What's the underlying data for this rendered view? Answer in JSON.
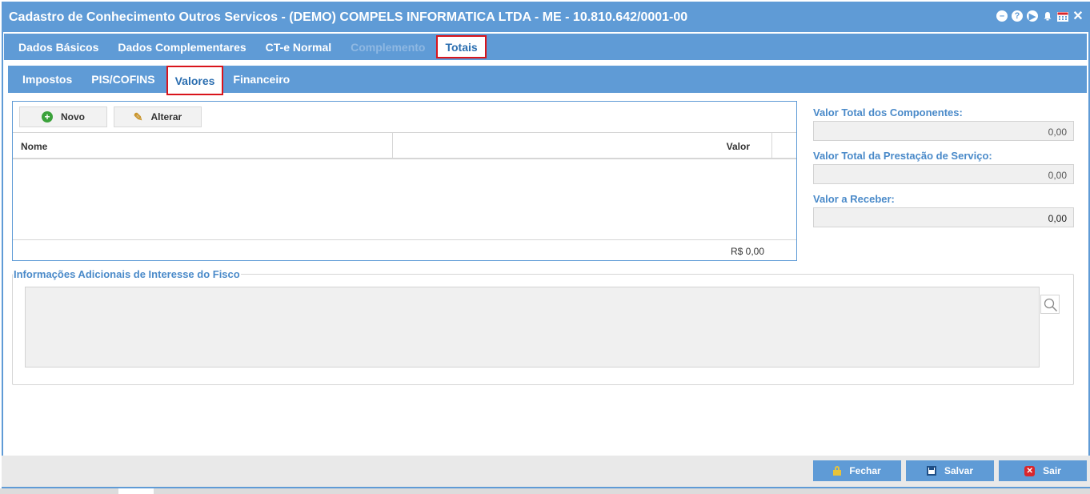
{
  "window": {
    "title": "Cadastro de Conhecimento Outros Servicos - (DEMO) COMPELS INFORMATICA LTDA - ME - 10.810.642/0001-00",
    "icons": [
      "minimize-icon",
      "help-icon",
      "play-icon",
      "bell-icon",
      "calendar-icon",
      "close-icon"
    ]
  },
  "main_tabs": [
    {
      "label": "Dados Básicos",
      "state": "normal"
    },
    {
      "label": "Dados Complementares",
      "state": "normal"
    },
    {
      "label": "CT-e Normal",
      "state": "normal"
    },
    {
      "label": "Complemento",
      "state": "disabled"
    },
    {
      "label": "Totais",
      "state": "active"
    }
  ],
  "sub_tabs": [
    {
      "label": "Impostos",
      "state": "normal"
    },
    {
      "label": "PIS/COFINS",
      "state": "normal"
    },
    {
      "label": "Valores",
      "state": "active"
    },
    {
      "label": "Financeiro",
      "state": "normal"
    }
  ],
  "grid": {
    "new_label": "Novo",
    "edit_label": "Alterar",
    "columns": [
      "Nome",
      "Valor"
    ],
    "rows": [],
    "total": "R$ 0,00"
  },
  "totals": {
    "componentes_label": "Valor Total dos Componentes:",
    "componentes_value": "0,00",
    "prestacao_label": "Valor Total da Prestação de Serviço:",
    "prestacao_value": "0,00",
    "receber_label": "Valor a Receber:",
    "receber_value": "0,00"
  },
  "fisco": {
    "legend": "Informações Adicionais de Interesse do Fisco",
    "value": ""
  },
  "footer": {
    "close_label": "Fechar",
    "save_label": "Salvar",
    "exit_label": "Sair"
  },
  "colors": {
    "accent": "#5f9bd6",
    "highlight": "#d9141b",
    "label": "#4a8ac9"
  }
}
